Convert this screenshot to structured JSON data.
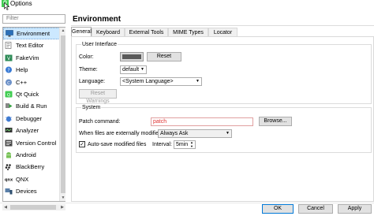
{
  "window": {
    "title": "Options",
    "app_icon": "qt-creator-icon"
  },
  "filter": {
    "placeholder": "Filter"
  },
  "sidebar": {
    "items": [
      {
        "label": "Environment",
        "icon": "monitor-icon",
        "selected": true
      },
      {
        "label": "Text Editor",
        "icon": "text-editor-icon"
      },
      {
        "label": "FakeVim",
        "icon": "fakevim-icon"
      },
      {
        "label": "Help",
        "icon": "help-icon"
      },
      {
        "label": "C++",
        "icon": "cpp-icon"
      },
      {
        "label": "Qt Quick",
        "icon": "qt-quick-icon"
      },
      {
        "label": "Build & Run",
        "icon": "build-run-icon"
      },
      {
        "label": "Debugger",
        "icon": "debugger-icon"
      },
      {
        "label": "Analyzer",
        "icon": "analyzer-icon"
      },
      {
        "label": "Version Control",
        "icon": "version-control-icon"
      },
      {
        "label": "Android",
        "icon": "android-icon"
      },
      {
        "label": "BlackBerry",
        "icon": "blackberry-icon"
      },
      {
        "label": "QNX",
        "icon": "qnx-icon"
      },
      {
        "label": "Devices",
        "icon": "devices-icon"
      }
    ]
  },
  "page": {
    "title": "Environment",
    "tabs": [
      "General",
      "Keyboard",
      "External Tools",
      "MIME Types",
      "Locator"
    ],
    "active_tab": "General"
  },
  "user_interface": {
    "group_title": "User Interface",
    "color_label": "Color:",
    "color_value": "#5a5a5a",
    "reset_label": "Reset",
    "theme_label": "Theme:",
    "theme_value": "default",
    "language_label": "Language:",
    "language_value": "<System Language>",
    "reset_warnings_label": "Reset Warnings"
  },
  "system": {
    "group_title": "System",
    "patch_label": "Patch command:",
    "patch_value": "patch",
    "browse_label": "Browse...",
    "external_label": "When files are externally modified:",
    "external_value": "Always Ask",
    "autosave_label": "Auto-save modified files",
    "autosave_checked": true,
    "interval_label": "Interval:",
    "interval_value": "5min"
  },
  "footer": {
    "ok_label": "OK",
    "cancel_label": "Cancel",
    "apply_label": "Apply"
  },
  "colors": {
    "selection": "#cce8ff",
    "accent": "#0078d7",
    "qt_green": "#41cd52",
    "error_text": "#e03030"
  }
}
